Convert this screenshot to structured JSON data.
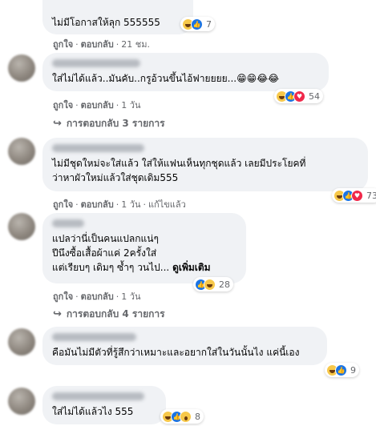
{
  "labels": {
    "like": "ถูกใจ",
    "reply": "ตอบกลับ",
    "dot": "·"
  },
  "comments": [
    {
      "lines": [
        "ไม่มีโอกาสให้ลุก 555555"
      ],
      "time": "21 ชม.",
      "reactions": [
        "haha",
        "like"
      ],
      "reaction_count": "7"
    },
    {
      "lines": [
        "ใส่ไม่ได้แล้ว..มันคับ..กรูอ้วนขึ้นไอ้ฟายยยย...😁😁😂😂"
      ],
      "time": "1 วัน",
      "reactions": [
        "haha",
        "like",
        "love"
      ],
      "reaction_count": "54",
      "replies": "การตอบกลับ 3 รายการ"
    },
    {
      "lines": [
        "ไม่มีชุดใหม่จะใส่แล้ว ใส่ให้แฟนเห็นทุกชุดแล้ว เลยมีประโยคที่",
        "ว่าหาผัวใหม่แล้วใส่ชุดเดิม555"
      ],
      "time": "1 วัน",
      "edited": "แก้ไขแล้ว",
      "reactions": [
        "haha",
        "like",
        "love"
      ],
      "reaction_count": "73"
    },
    {
      "lines": [
        "แปลว่านี่เป็นคนแปลกแน่ๆ",
        "ปีนึงซื้อเสื้อผ้าแค่ 2ครั้งใส่",
        "แต่เรียบๆ เดิมๆ ซ้ำๆ วนไป..."
      ],
      "see_more": "ดูเพิ่มเติม",
      "time": "1 วัน",
      "reactions": [
        "like",
        "haha"
      ],
      "reaction_count": "28",
      "replies": "การตอบกลับ 4 รายการ"
    },
    {
      "lines": [
        "คือมันไม่มีตัวที่รู้สึกว่าเหมาะและอยากใส่ในวันนั้นไง แค่นี้เอง"
      ],
      "reactions": [
        "haha",
        "like"
      ],
      "reaction_count": "9"
    },
    {
      "lines": [
        "ใส่ไม่ได้แล้วไง 555"
      ],
      "reactions": [
        "haha",
        "like",
        "wow"
      ],
      "reaction_count": "8"
    }
  ],
  "colors": {
    "bubble": "#f0f2f5",
    "meta_text": "#65676b",
    "like_blue": "#1b74e4",
    "love_red": "#f0284a",
    "haha_yellow": "#f7c84a"
  }
}
